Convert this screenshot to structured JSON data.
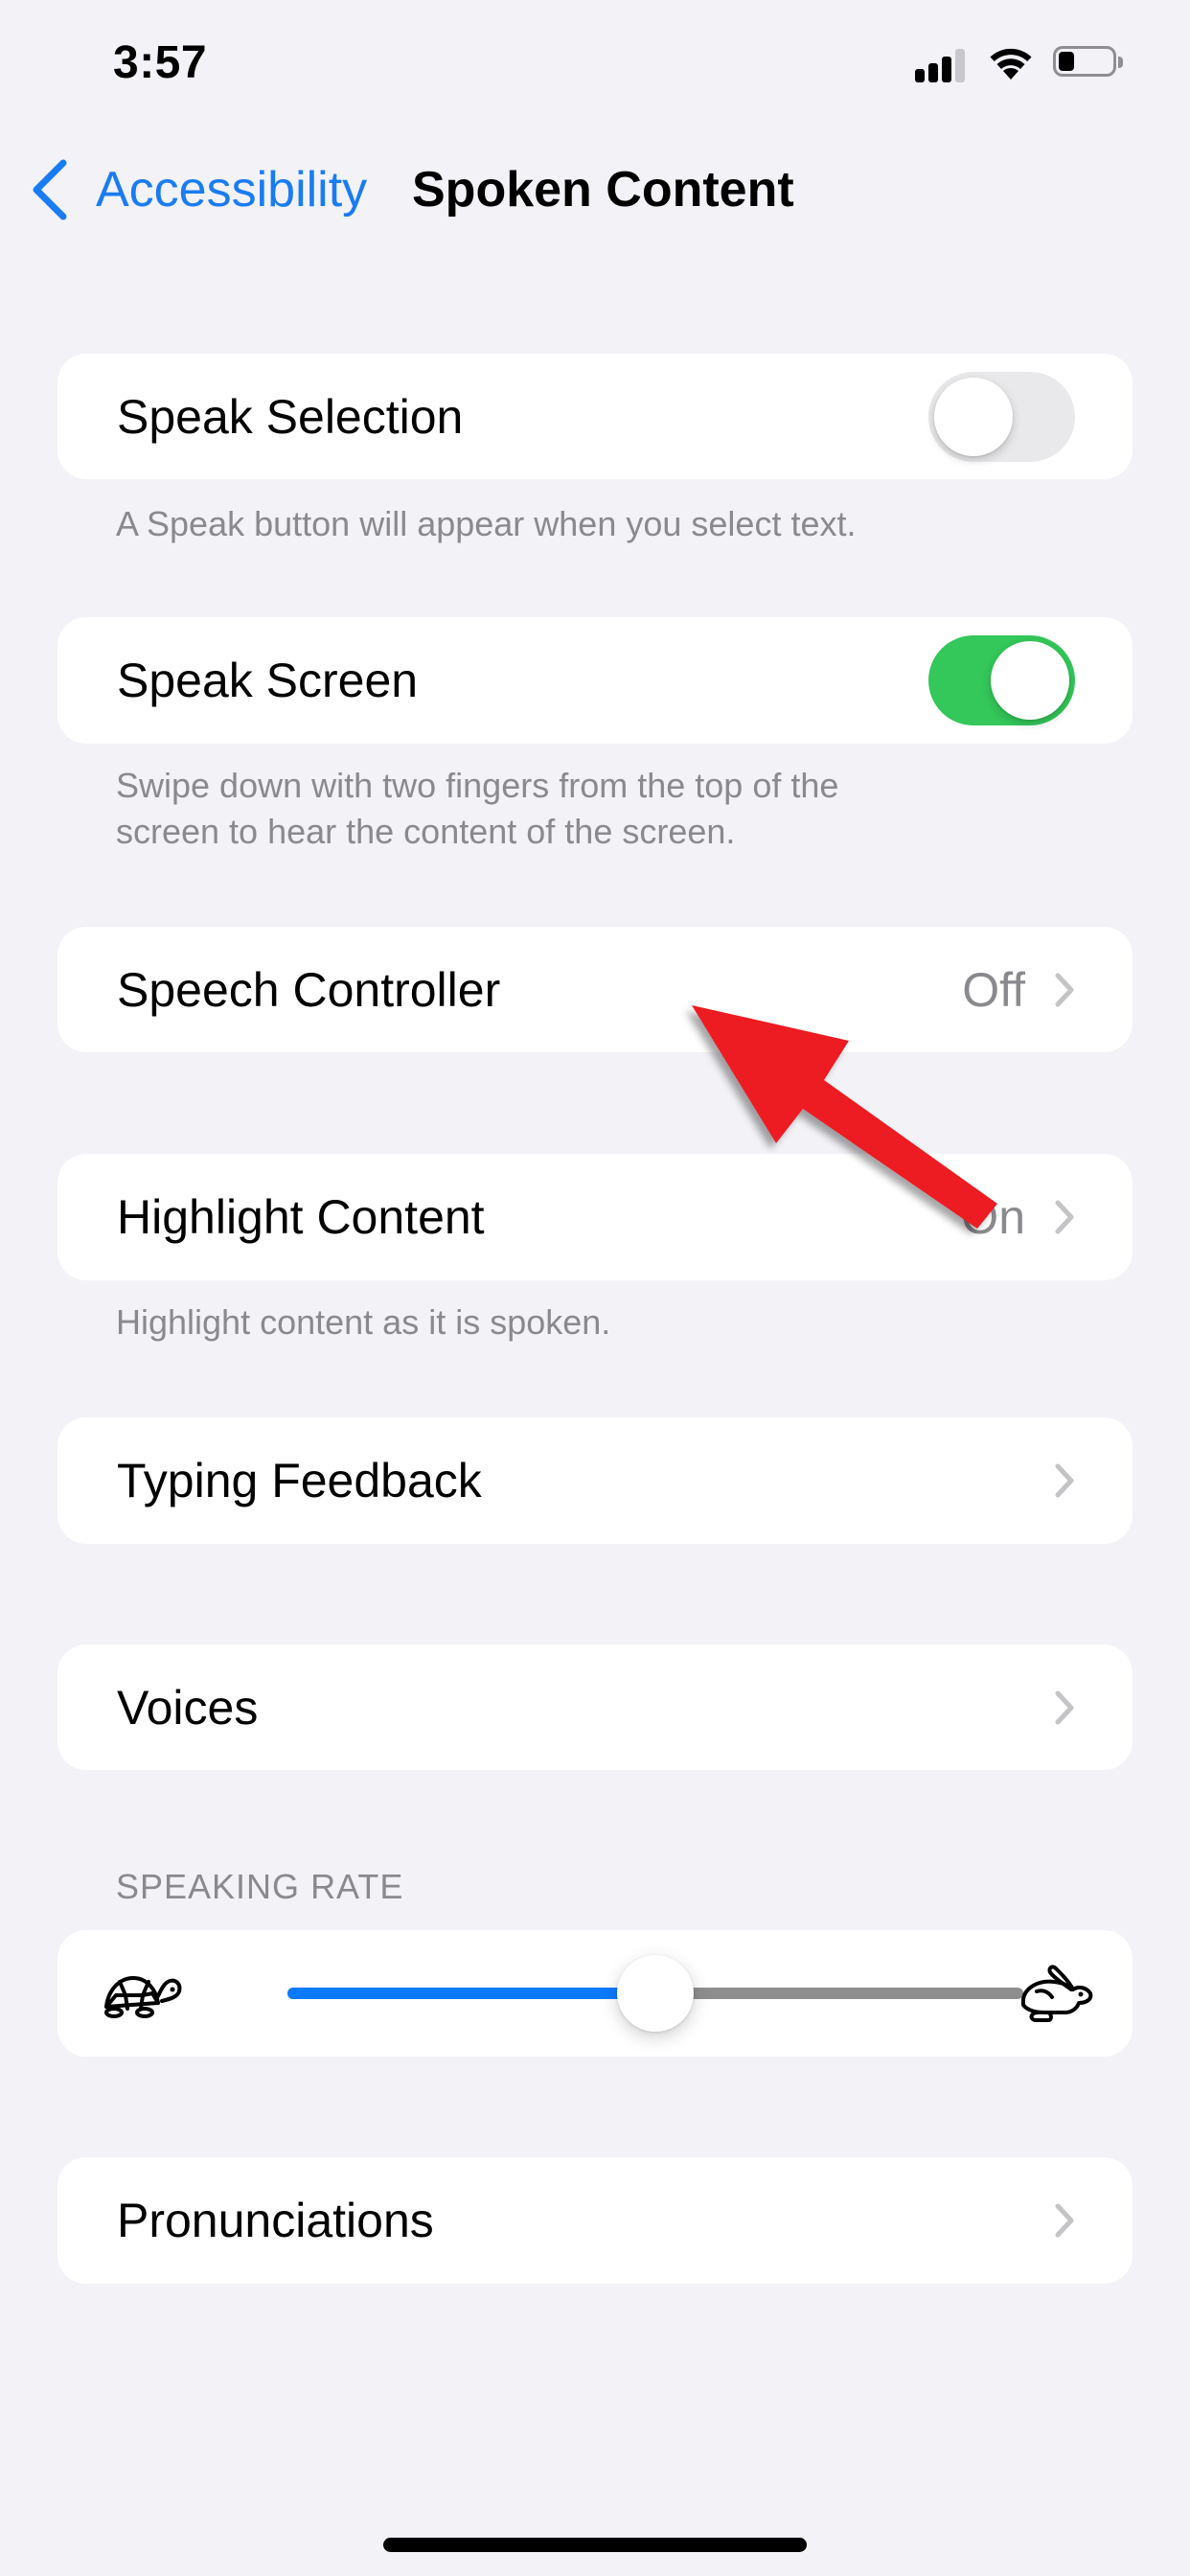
{
  "status_bar": {
    "time": "3:57",
    "signal_bars": 3,
    "signal_bars_total": 4,
    "wifi": "connected",
    "battery_level": 0.3
  },
  "nav": {
    "back_label": "Accessibility",
    "title": "Spoken Content"
  },
  "colors": {
    "accent": "#1a7cf2",
    "toggle_on": "#34c759",
    "toggle_off": "#e9e9eb",
    "slider_fill": "#0a7aff",
    "slider_track": "#8e8e8e",
    "annotation_arrow": "#ec1c24"
  },
  "settings": {
    "speak_selection": {
      "label": "Speak Selection",
      "enabled": false,
      "footer": "A Speak button will appear when you select text."
    },
    "speak_screen": {
      "label": "Speak Screen",
      "enabled": true,
      "footer_line1": "Swipe down with two fingers from the top of the",
      "footer_line2": "screen to hear the content of the screen."
    },
    "speech_controller": {
      "label": "Speech Controller",
      "value": "Off"
    },
    "highlight_content": {
      "label": "Highlight Content",
      "value": "On",
      "footer": "Highlight content as it is spoken."
    },
    "typing_feedback": {
      "label": "Typing Feedback"
    },
    "voices": {
      "label": "Voices"
    },
    "speaking_rate": {
      "header": "SPEAKING RATE",
      "value": 0.5,
      "min_icon": "turtle-icon",
      "max_icon": "rabbit-icon"
    },
    "pronunciations": {
      "label": "Pronunciations"
    }
  },
  "annotation": {
    "type": "arrow",
    "points_to": "Speech Controller"
  }
}
